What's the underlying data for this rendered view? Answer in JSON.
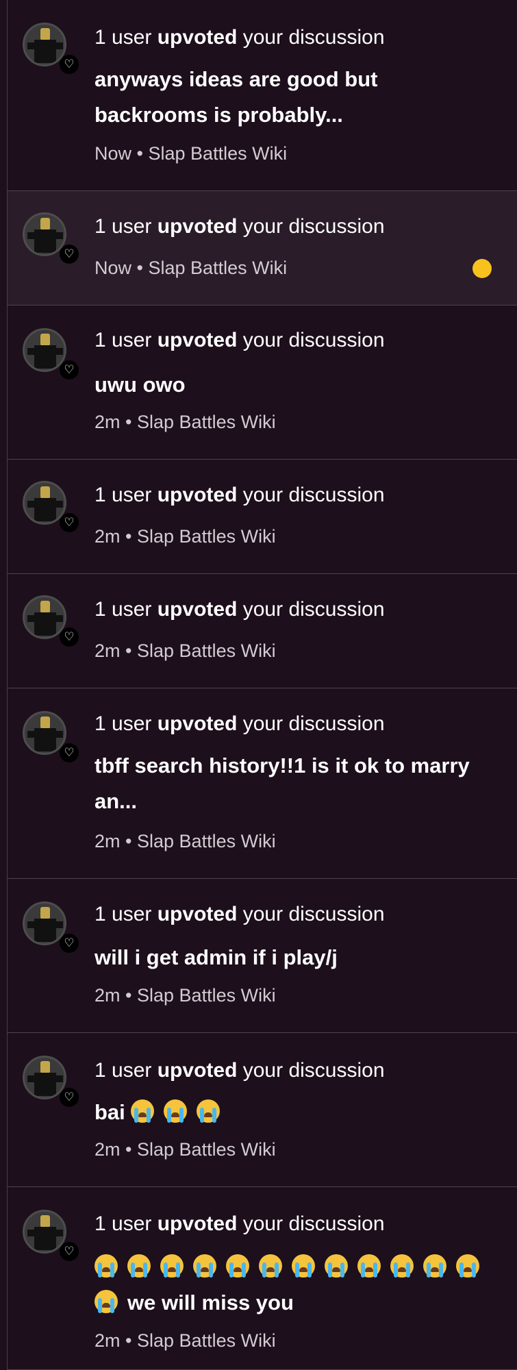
{
  "colors": {
    "background": "#1d0f1c",
    "unread_background": "#2a1c29",
    "divider": "#4f4350",
    "text": "#ffffff",
    "meta_text": "#d3ccd2",
    "unread_dot": "#f7c21e"
  },
  "avatar_icon": "roblox-avatar",
  "badge_icon": "heart-icon",
  "notifications": [
    {
      "count": "1 user",
      "action": "upvoted",
      "suffix": "your discussion",
      "title": "anyways ideas are good but backrooms is probably...",
      "time": "Now",
      "separator": "•",
      "wiki": "Slap Battles Wiki",
      "unread": false
    },
    {
      "count": "1 user",
      "action": "upvoted",
      "suffix": "your discussion",
      "title": "",
      "time": "Now",
      "separator": "•",
      "wiki": "Slap Battles Wiki",
      "unread": true
    },
    {
      "count": "1 user",
      "action": "upvoted",
      "suffix": "your discussion",
      "title": "uwu owo",
      "time": "2m",
      "separator": "•",
      "wiki": "Slap Battles Wiki",
      "unread": false
    },
    {
      "count": "1 user",
      "action": "upvoted",
      "suffix": "your discussion",
      "title": "",
      "time": "2m",
      "separator": "•",
      "wiki": "Slap Battles Wiki",
      "unread": false
    },
    {
      "count": "1 user",
      "action": "upvoted",
      "suffix": "your discussion",
      "title": "",
      "time": "2m",
      "separator": "•",
      "wiki": "Slap Battles Wiki",
      "unread": false
    },
    {
      "count": "1 user",
      "action": "upvoted",
      "suffix": "your discussion",
      "title": "tbff search history!!1 is it ok to marry an...",
      "time": "2m",
      "separator": "•",
      "wiki": "Slap Battles Wiki",
      "unread": false
    },
    {
      "count": "1 user",
      "action": "upvoted",
      "suffix": "your discussion",
      "title": "will i get admin if i play/j",
      "time": "2m",
      "separator": "•",
      "wiki": "Slap Battles Wiki",
      "unread": false
    },
    {
      "count": "1 user",
      "action": "upvoted",
      "suffix": "your discussion",
      "title": "bai",
      "title_emoji": "loudly-crying-face",
      "title_emoji_count": 3,
      "time": "2m",
      "separator": "•",
      "wiki": "Slap Battles Wiki",
      "unread": false
    },
    {
      "count": "1 user",
      "action": "upvoted",
      "suffix": "your discussion",
      "title": "we will miss you",
      "title_emoji": "loudly-crying-face",
      "title_emoji_count": 13,
      "time": "2m",
      "separator": "•",
      "wiki": "Slap Battles Wiki",
      "unread": false
    }
  ]
}
